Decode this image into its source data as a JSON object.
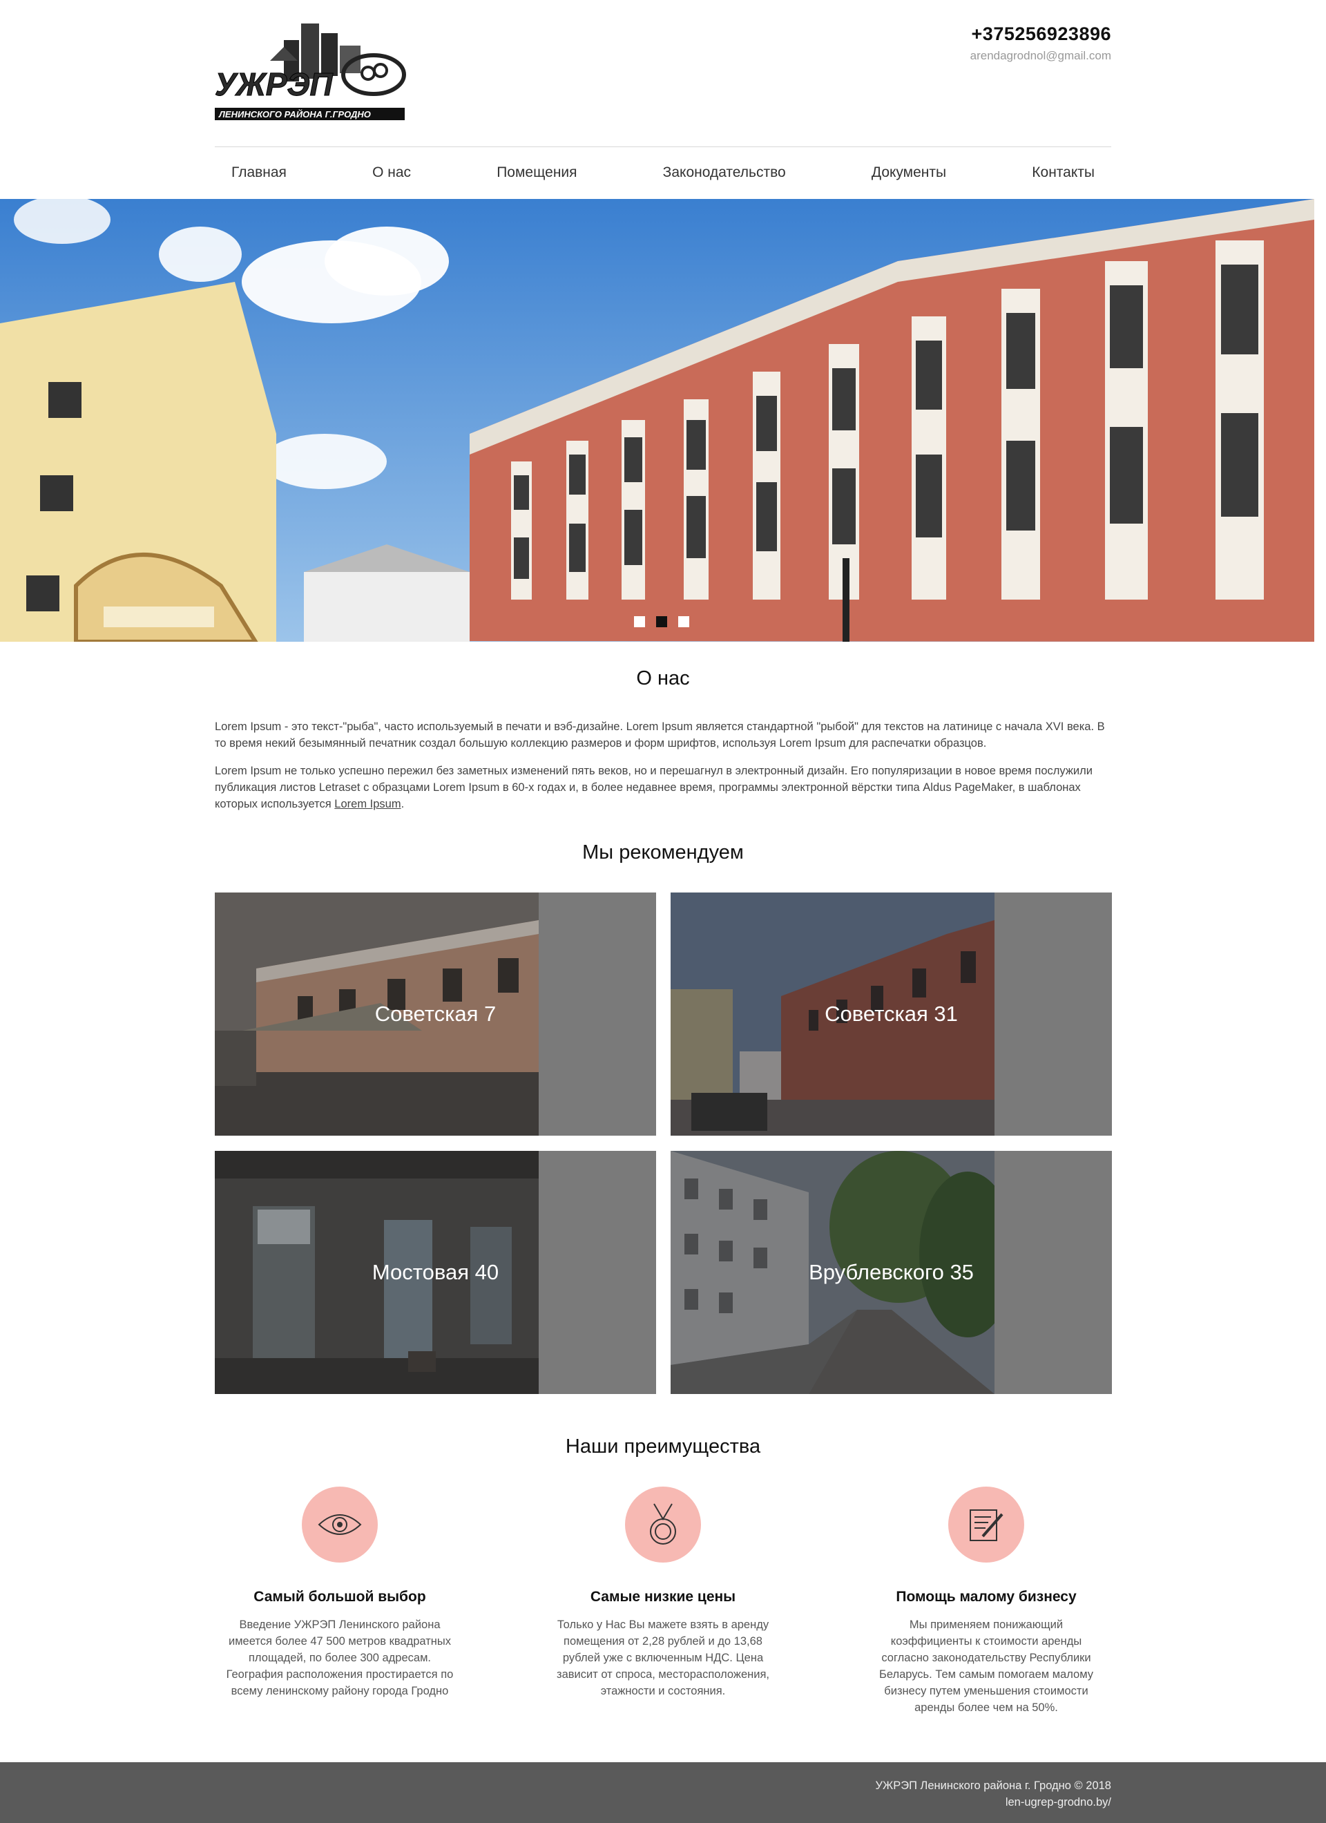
{
  "header": {
    "logo_text": "УЖРЭП",
    "logo_subtitle": "ЛЕНИНСКОГО РАЙОНА Г.ГРОДНО",
    "phone": "+375256923896",
    "email": "arendagrodnol@gmail.com"
  },
  "nav": {
    "items": [
      {
        "label": "Главная"
      },
      {
        "label": "О нас"
      },
      {
        "label": "Помещения"
      },
      {
        "label": "Законодательство"
      },
      {
        "label": "Документы"
      },
      {
        "label": "Контакты"
      }
    ]
  },
  "slider": {
    "slides": 3,
    "active": 2
  },
  "about": {
    "title": "О нас",
    "p1": "Lorem Ipsum - это текст-\"рыба\", часто используемый в печати и вэб-дизайне. Lorem Ipsum является стандартной \"рыбой\" для текстов на латинице с начала XVI века. В то время некий безымянный печатник создал большую коллекцию размеров и форм шрифтов, используя Lorem Ipsum для распечатки образцов.",
    "p2": "Lorem Ipsum не только успешно пережил без заметных изменений пять веков, но и перешагнул в электронный дизайн. Его популяризации в новое время послужили публикация листов Letraset с образцами Lorem Ipsum в 60-х годах и, в более недавнее время, программы электронной вёрстки типа Aldus PageMaker, в шаблонах которых используется ",
    "p2_link": "Lorem Ipsum",
    "p2_end": "."
  },
  "recommend": {
    "title": "Мы рекомендуем",
    "cards": [
      {
        "label": "Советская 7"
      },
      {
        "label": "Советская 31"
      },
      {
        "label": "Мостовая 40"
      },
      {
        "label": "Врублевского 35"
      }
    ]
  },
  "advantages": {
    "title": "Наши преимущества",
    "items": [
      {
        "icon": "eye-icon",
        "title": "Самый большой выбор",
        "text": "Введение УЖРЭП Ленинского района имеется более 47 500 метров квадратных площадей, по более 300 адресам. География расположения простирается по всему ленинскому району города Гродно"
      },
      {
        "icon": "medal-icon",
        "title": "Самые низкие цены",
        "text": "Только у Нас Вы мажете взять в аренду помещения от 2,28 рублей и до 13,68 рублей уже с включенным НДС. Цена зависит от спроса, месторасположения, этажности и состояния."
      },
      {
        "icon": "document-pen-icon",
        "title": "Помощь малому бизнесу",
        "text": "Мы применяем понижающий коэффициенты к стоимости аренды согласно законодательству Республики Беларусь. Тем самым помогаем малому бизнесу путем уменьшения стоимости аренды более чем на 50%."
      }
    ],
    "accent_color": "#f7b9b3"
  },
  "footer": {
    "copyright": "УЖРЭП Ленинского района г. Гродно © 2018",
    "site": "len-ugrep-grodno.by/"
  }
}
